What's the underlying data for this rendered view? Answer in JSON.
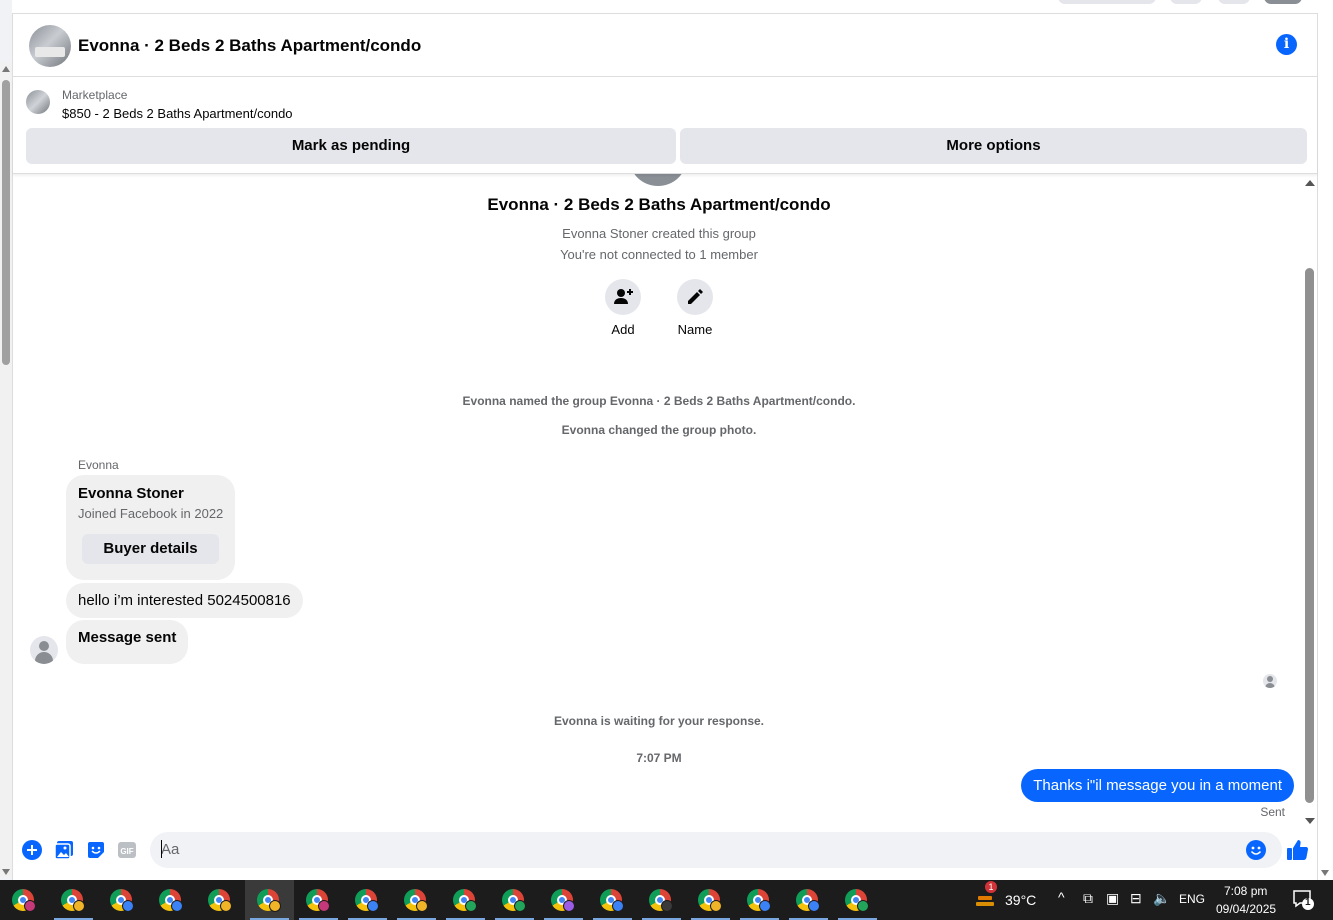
{
  "header": {
    "title": "Evonna · 2 Beds 2 Baths Apartment/condo",
    "info_icon": "info-icon"
  },
  "marketplace": {
    "label": "Marketplace",
    "price_title": "$850 - 2 Beds 2 Baths Apartment/condo",
    "mark_pending_label": "Mark as pending",
    "more_options_label": "More options"
  },
  "group": {
    "title": "Evonna · 2 Beds 2 Baths Apartment/condo",
    "created": "Evonna Stoner created this group",
    "connected": "You're not connected to 1 member",
    "add_label": "Add",
    "name_label": "Name"
  },
  "system": {
    "named": "Evonna named the group Evonna · 2 Beds 2 Baths Apartment/condo.",
    "photo": "Evonna changed the group photo.",
    "waiting": "Evonna is waiting for your response.",
    "time": "7:07 PM"
  },
  "messages": {
    "sender": "Evonna",
    "card_name": "Evonna Stoner",
    "card_joined": "Joined Facebook in 2022",
    "card_button": "Buyer details",
    "msg1": "hello i’m interested 5024500816",
    "msg2": "Message sent",
    "outgoing": "Thanks i\"il message you in a moment",
    "status": "Sent"
  },
  "composer": {
    "placeholder": "Aa"
  },
  "taskbar": {
    "temperature": "39°C",
    "language": "ENG",
    "time": "7:08 pm",
    "date": "09/04/2025",
    "weather_alert": "1",
    "notification_count": "1"
  },
  "colors": {
    "accent": "#0866ff",
    "bubble_in": "#f0f0f0",
    "button_grey": "#e4e6eb",
    "taskbar": "#1c1c1c"
  }
}
